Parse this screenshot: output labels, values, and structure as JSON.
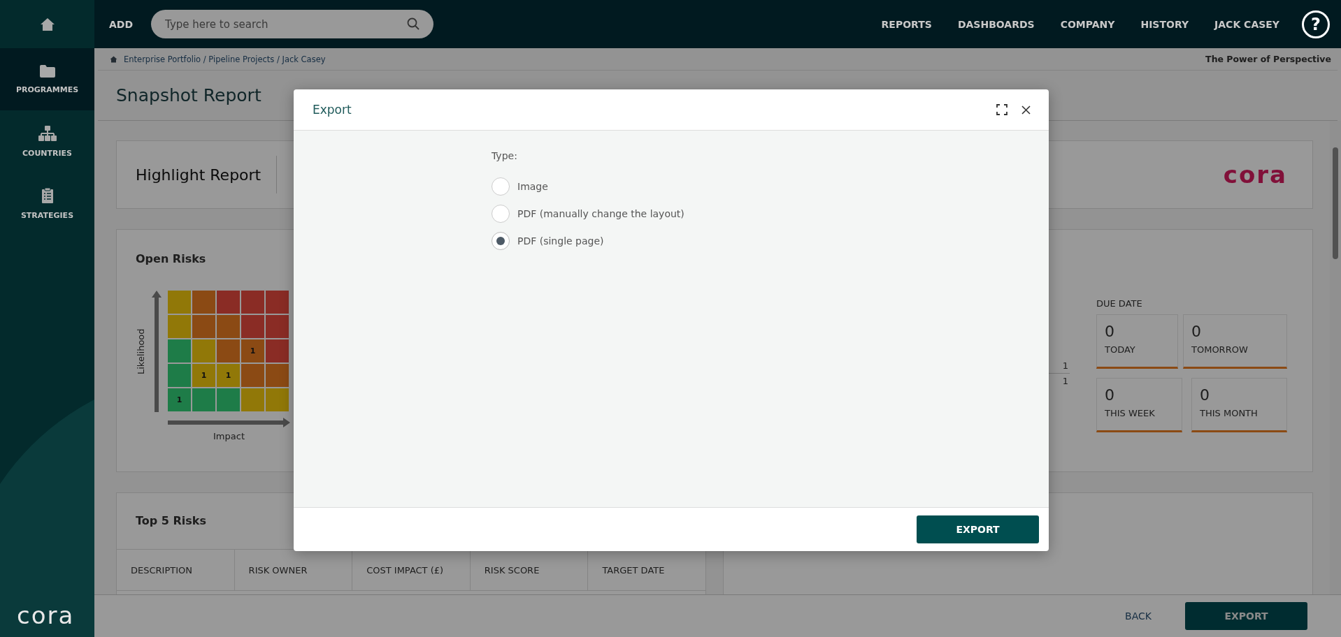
{
  "sidebar": {
    "items": [
      {
        "label": "PROGRAMMES",
        "selected": true
      },
      {
        "label": "COUNTRIES",
        "selected": false
      },
      {
        "label": "STRATEGIES",
        "selected": false
      }
    ],
    "logo": "cora"
  },
  "topbar": {
    "add": "ADD",
    "search": {
      "placeholder": "Type here to search"
    },
    "nav": [
      "REPORTS",
      "DASHBOARDS",
      "COMPANY",
      "HISTORY",
      "JACK CASEY"
    ],
    "help": "?"
  },
  "breadcrumb": "Enterprise Portfolio / Pipeline Projects / Jack Casey",
  "tagline": "The Power of Perspective",
  "page_title": "Snapshot Report",
  "highlight": {
    "title": "Highlight Report",
    "logo": "cora"
  },
  "open_risks": {
    "title": "Open Risks",
    "y_axis": "Likelihood",
    "x_axis": "Impact",
    "matrix": [
      [
        {
          "color": "#917808"
        },
        {
          "color": "#8b4a14"
        },
        {
          "color": "#8a2c25"
        },
        {
          "color": "#8a2c25"
        },
        {
          "color": "#8a2c25"
        }
      ],
      [
        {
          "color": "#917808"
        },
        {
          "color": "#8b4a14"
        },
        {
          "color": "#8b4a14"
        },
        {
          "color": "#8a2c25"
        },
        {
          "color": "#8a2c25"
        }
      ],
      [
        {
          "color": "#1e7c48"
        },
        {
          "color": "#917808"
        },
        {
          "color": "#8b4a14"
        },
        {
          "color": "#8b4a14",
          "count": "1"
        },
        {
          "color": "#8a2c25"
        }
      ],
      [
        {
          "color": "#1e7c48"
        },
        {
          "color": "#917808",
          "count": "1"
        },
        {
          "color": "#917808",
          "count": "1"
        },
        {
          "color": "#8b4a14"
        },
        {
          "color": "#8b4a14"
        }
      ],
      [
        {
          "color": "#1e7c48",
          "count": "1"
        },
        {
          "color": "#1e7c48"
        },
        {
          "color": "#1e7c48"
        },
        {
          "color": "#917808"
        },
        {
          "color": "#917808"
        }
      ]
    ],
    "counts": [
      "1",
      "1"
    ],
    "due_date": {
      "title": "DUE DATE",
      "tiles": [
        {
          "value": "0",
          "label": "TODAY"
        },
        {
          "value": "0",
          "label": "TOMORROW"
        },
        {
          "value": "0",
          "label": "THIS WEEK"
        },
        {
          "value": "0",
          "label": "THIS MONTH"
        }
      ]
    }
  },
  "top_risks": {
    "title": "Top 5 Risks",
    "columns": [
      "DESCRIPTION",
      "RISK OWNER",
      "COST IMPACT (£)",
      "RISK SCORE",
      "TARGET DATE"
    ]
  },
  "footer": {
    "back": "BACK",
    "export": "EXPORT"
  },
  "modal": {
    "title": "Export",
    "type_label": "Type:",
    "options": [
      {
        "label": "Image",
        "selected": false
      },
      {
        "label": "PDF (manually change the layout)",
        "selected": false
      },
      {
        "label": "PDF (single page)",
        "selected": true
      }
    ],
    "button": "EXPORT"
  }
}
